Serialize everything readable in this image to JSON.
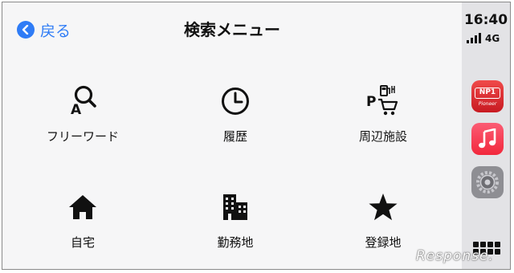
{
  "header": {
    "back_label": "戻る",
    "title": "検索メニュー"
  },
  "menu": {
    "items": [
      {
        "label": "フリーワード",
        "icon": "freeword-search-icon"
      },
      {
        "label": "履歴",
        "icon": "clock-icon"
      },
      {
        "label": "周辺施設",
        "icon": "nearby-facilities-icon"
      },
      {
        "label": "自宅",
        "icon": "home-icon"
      },
      {
        "label": "勤務地",
        "icon": "office-building-icon"
      },
      {
        "label": "登録地",
        "icon": "star-icon"
      }
    ]
  },
  "status": {
    "time": "16:40",
    "network": "4G",
    "signal_bars": 4
  },
  "sidebar": {
    "apps": [
      {
        "name": "NP1",
        "brand": "Pioneer",
        "color": "#d9232d"
      },
      {
        "name": "music",
        "color": "#f5364b"
      },
      {
        "name": "settings",
        "color": "#8e8e93"
      }
    ]
  },
  "watermark": "Response.",
  "colors": {
    "accent": "#2f7cf6",
    "background": "#f6f6f7",
    "sidebar": "#e3e3e6"
  }
}
